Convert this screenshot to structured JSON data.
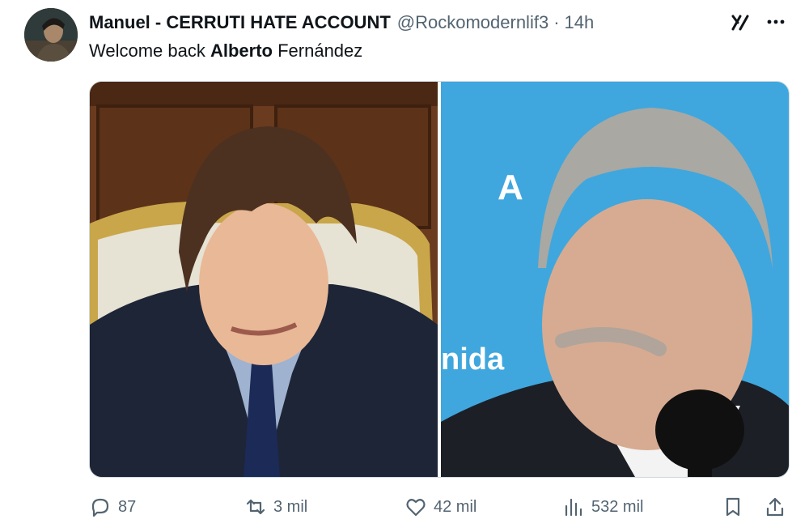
{
  "tweet": {
    "author_name": "Manuel - CERRUTI HATE ACCOUNT",
    "handle": "@Rockomodernlif3",
    "separator": "·",
    "time": "14h",
    "text_prefix": "Welcome back ",
    "text_bold": "Alberto",
    "text_suffix": " Fernández"
  },
  "media": {
    "left_sign_text": "A",
    "right_sign_text": "nida"
  },
  "actions": {
    "replies": "87",
    "retweets": "3 mil",
    "likes": "42 mil",
    "views": "532 mil"
  },
  "icons": [
    "avatar",
    "grok-icon",
    "more-icon",
    "reply-icon",
    "retweet-icon",
    "like-icon",
    "views-icon",
    "bookmark-icon",
    "share-icon"
  ],
  "colors": {
    "text": "#0f1419",
    "secondary": "#536471",
    "border": "#cfd9de"
  }
}
